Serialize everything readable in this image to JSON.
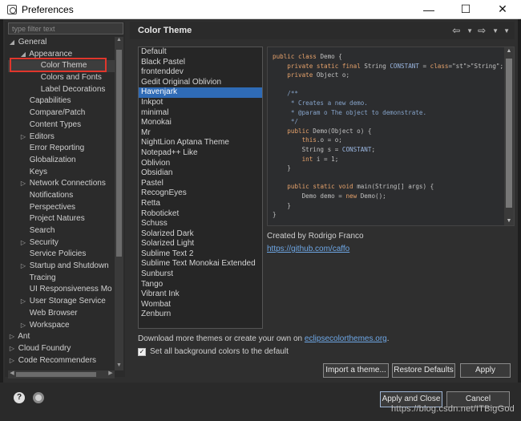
{
  "window": {
    "title": "Preferences",
    "minimize": "—",
    "maximize": "☐",
    "close": "✕"
  },
  "filter": {
    "placeholder": "type filter text"
  },
  "tree": [
    {
      "label": "General",
      "indent": 0,
      "twisty": "◢"
    },
    {
      "label": "Appearance",
      "indent": 1,
      "twisty": "◢"
    },
    {
      "label": "Color Theme",
      "indent": 2,
      "twisty": "",
      "selected": true
    },
    {
      "label": "Colors and Fonts",
      "indent": 2,
      "twisty": ""
    },
    {
      "label": "Label Decorations",
      "indent": 2,
      "twisty": ""
    },
    {
      "label": "Capabilities",
      "indent": 1,
      "twisty": ""
    },
    {
      "label": "Compare/Patch",
      "indent": 1,
      "twisty": ""
    },
    {
      "label": "Content Types",
      "indent": 1,
      "twisty": ""
    },
    {
      "label": "Editors",
      "indent": 1,
      "twisty": "▷"
    },
    {
      "label": "Error Reporting",
      "indent": 1,
      "twisty": ""
    },
    {
      "label": "Globalization",
      "indent": 1,
      "twisty": ""
    },
    {
      "label": "Keys",
      "indent": 1,
      "twisty": ""
    },
    {
      "label": "Network Connections",
      "indent": 1,
      "twisty": "▷"
    },
    {
      "label": "Notifications",
      "indent": 1,
      "twisty": ""
    },
    {
      "label": "Perspectives",
      "indent": 1,
      "twisty": ""
    },
    {
      "label": "Project Natures",
      "indent": 1,
      "twisty": ""
    },
    {
      "label": "Search",
      "indent": 1,
      "twisty": ""
    },
    {
      "label": "Security",
      "indent": 1,
      "twisty": "▷"
    },
    {
      "label": "Service Policies",
      "indent": 1,
      "twisty": ""
    },
    {
      "label": "Startup and Shutdown",
      "indent": 1,
      "twisty": "▷"
    },
    {
      "label": "Tracing",
      "indent": 1,
      "twisty": ""
    },
    {
      "label": "UI Responsiveness Mo",
      "indent": 1,
      "twisty": ""
    },
    {
      "label": "User Storage Service",
      "indent": 1,
      "twisty": "▷"
    },
    {
      "label": "Web Browser",
      "indent": 1,
      "twisty": ""
    },
    {
      "label": "Workspace",
      "indent": 1,
      "twisty": "▷"
    },
    {
      "label": "Ant",
      "indent": 0,
      "twisty": "▷"
    },
    {
      "label": "Cloud Foundry",
      "indent": 0,
      "twisty": "▷"
    },
    {
      "label": "Code Recommenders",
      "indent": 0,
      "twisty": "▷"
    }
  ],
  "page": {
    "title": "Color Theme",
    "back": "⇦",
    "forward": "⇨"
  },
  "themes": [
    "Default",
    "Black Pastel",
    "frontenddev",
    "Gedit Original Oblivion",
    "Havenjark",
    "Inkpot",
    "minimal",
    "Monokai",
    "Mr",
    "NightLion Aptana Theme",
    "Notepad++ Like",
    "Oblivion",
    "Obsidian",
    "Pastel",
    "RecognEyes",
    "Retta",
    "Roboticket",
    "Schuss",
    "Solarized Dark",
    "Solarized Light",
    "Sublime Text 2",
    "Sublime Text Monokai Extended",
    "Sunburst",
    "Tango",
    "Vibrant Ink",
    "Wombat",
    "Zenburn"
  ],
  "selected_theme": "Havenjark",
  "code_preview": [
    "public class Demo {",
    "    private static final String CONSTANT = \"String\";",
    "    private Object o;",
    "",
    "    /**",
    "     * Creates a new demo.",
    "     * @param o The object to demonstrate.",
    "     */",
    "    public Demo(Object o) {",
    "        this.o = o;",
    "        String s = CONSTANT;",
    "        int i = 1;",
    "    }",
    "",
    "    public static void main(String[] args) {",
    "        Demo demo = new Demo();",
    "    }",
    "}"
  ],
  "author": {
    "created_by": "Created by Rodrigo Franco",
    "url": "https://github.com/caffo"
  },
  "download": {
    "text": "Download more themes or create your own on ",
    "link": "eclipsecolorthemes.org",
    "suffix": "."
  },
  "checkbox": {
    "label": "Set all background colors to the default",
    "checked": true
  },
  "buttons": {
    "import": "Import a theme...",
    "restore": "Restore Defaults",
    "apply": "Apply",
    "apply_close": "Apply and Close",
    "cancel": "Cancel"
  },
  "watermark": "https://blog.csdn.net/ITBigGod",
  "colors": {
    "selection": "#2f6bb6",
    "link": "#6ea7e6",
    "highlight_box": "#e0362c"
  }
}
